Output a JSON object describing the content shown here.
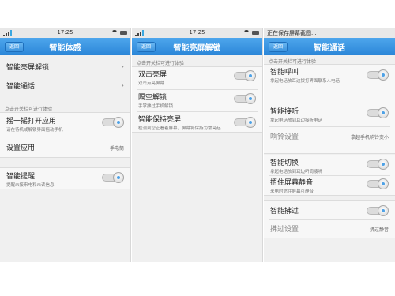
{
  "screens": [
    {
      "status_time": "17:25",
      "back_label": "返回",
      "title": "智能体感",
      "items": [
        {
          "label": "智能亮屏解锁",
          "chevron": "›"
        },
        {
          "label": "智能通话",
          "chevron": "›"
        }
      ],
      "section_label": "点击开关栏可进行体验",
      "shake": {
        "label": "摇一摇打开应用",
        "sub": "请在待机或解锁界面摇动手机"
      },
      "setapp": {
        "label": "设置应用",
        "value": "手电筒"
      },
      "remind": {
        "label": "智能提醒",
        "sub": "提醒未接来电和未读信息"
      }
    },
    {
      "status_time": "17:25",
      "back_label": "返回",
      "title": "智能亮屏解锁",
      "section_label": "点击开关栏可进行体验",
      "items": [
        {
          "label": "双击亮屏",
          "sub": "双击点亮屏幕"
        },
        {
          "label": "隔空解锁",
          "sub": "手掌拂过手机解锁"
        },
        {
          "label": "智能保持亮屏",
          "sub": "检测到您正看着屏幕，屏幕将保持为常亮起"
        }
      ]
    },
    {
      "status_text": "正在保存屏幕截图...",
      "back_label": "返回",
      "title": "智能通话",
      "section_label": "点击开关栏可进行体验",
      "call": {
        "label": "智能呼叫",
        "sub": "拿起电话放耳边拨打界面联系人电话"
      },
      "answer": {
        "label": "智能接听",
        "sub": "拿起电话放到耳边接听电话"
      },
      "ring": {
        "label": "响铃设置",
        "value": "拿起手机响铃变小"
      },
      "switch": {
        "label": "智能切换",
        "sub": "拿起电话放到耳边听筒接听"
      },
      "mute": {
        "label": "捂住屏幕静音",
        "sub": "来电时遮住屏幕可静音"
      },
      "reject": {
        "label": "智能拂过"
      },
      "reject_setting": {
        "label": "拂过设置",
        "value": "拂过静音"
      }
    }
  ]
}
